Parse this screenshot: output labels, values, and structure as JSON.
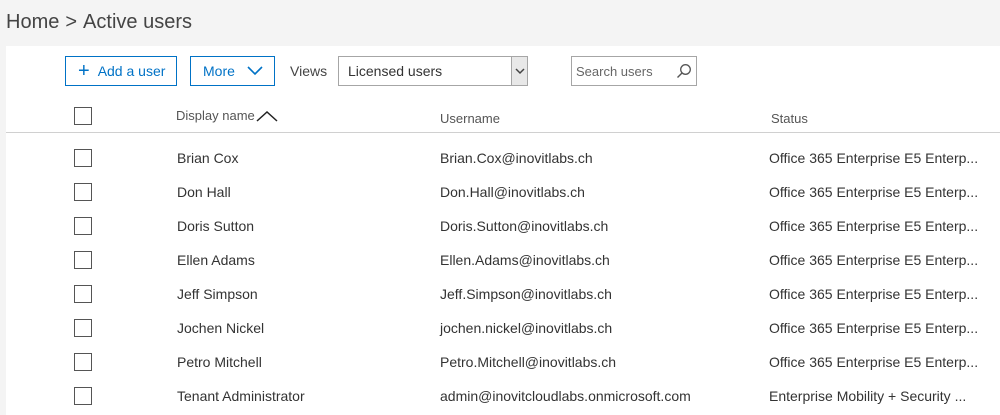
{
  "breadcrumb": {
    "home": "Home",
    "separator": ">",
    "current": "Active users"
  },
  "toolbar": {
    "add_user_label": "Add a user",
    "more_label": "More",
    "views_label": "Views",
    "views_selected": "Licensed users",
    "search_placeholder": "Search users"
  },
  "table": {
    "columns": {
      "display_name": "Display name",
      "username": "Username",
      "status": "Status"
    },
    "sort": {
      "column": "display_name",
      "direction": "ascending"
    },
    "rows": [
      {
        "display_name": "Brian Cox",
        "username": "Brian.Cox@inovitlabs.ch",
        "status": "Office 365 Enterprise E5 Enterp..."
      },
      {
        "display_name": "Don Hall",
        "username": "Don.Hall@inovitlabs.ch",
        "status": "Office 365 Enterprise E5 Enterp..."
      },
      {
        "display_name": "Doris Sutton",
        "username": "Doris.Sutton@inovitlabs.ch",
        "status": "Office 365 Enterprise E5 Enterp..."
      },
      {
        "display_name": "Ellen Adams",
        "username": "Ellen.Adams@inovitlabs.ch",
        "status": "Office 365 Enterprise E5 Enterp..."
      },
      {
        "display_name": "Jeff Simpson",
        "username": "Jeff.Simpson@inovitlabs.ch",
        "status": "Office 365 Enterprise E5 Enterp..."
      },
      {
        "display_name": "Jochen Nickel",
        "username": "jochen.nickel@inovitlabs.ch",
        "status": "Office 365 Enterprise E5 Enterp..."
      },
      {
        "display_name": "Petro Mitchell",
        "username": "Petro.Mitchell@inovitlabs.ch",
        "status": "Office 365 Enterprise E5 Enterp..."
      },
      {
        "display_name": "Tenant Administrator",
        "username": "admin@inovitcloudlabs.onmicrosoft.com",
        "status": "Enterprise Mobility + Security ..."
      }
    ]
  },
  "colors": {
    "accent": "#0072c6",
    "text": "#333333",
    "border": "#a6a6a6",
    "background": "#f4f4f4"
  },
  "icons": [
    "plus-icon",
    "chevron-down-icon",
    "dropdown-arrow-icon",
    "search-icon",
    "sort-ascending-icon"
  ]
}
